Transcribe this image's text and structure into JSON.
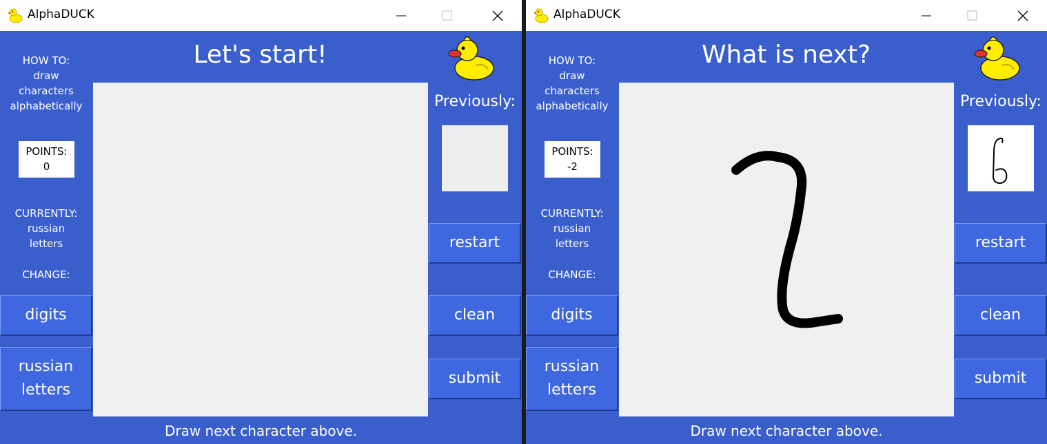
{
  "app": {
    "title": "AlphaDUCK"
  },
  "colors": {
    "background": "#3a5fcd",
    "button": "#3f68e0",
    "canvas": "#f0f0f0",
    "duck_yellow": "#ffee00",
    "duck_beak": "#e53030"
  },
  "windows": [
    {
      "heading": "Let's start!",
      "howto_label": "HOW TO:",
      "howto_text": "draw characters alphabetically",
      "points_label": "POINTS:",
      "points_value": "0",
      "currently_label": "CURRENTLY:",
      "currently_value": "russian letters",
      "change_label": "CHANGE:",
      "buttons": {
        "digits": "digits",
        "russian": "russian letters",
        "restart": "restart",
        "clean": "clean",
        "submit": "submit"
      },
      "previously_label": "Previously:",
      "footer": "Draw next character above.",
      "canvas_has_drawing": false,
      "previous_character": ""
    },
    {
      "heading": "What is next?",
      "howto_label": "HOW TO:",
      "howto_text": "draw characters alphabetically",
      "points_label": "POINTS:",
      "points_value": "-2",
      "currently_label": "CURRENTLY:",
      "currently_value": "russian letters",
      "change_label": "CHANGE:",
      "buttons": {
        "digits": "digits",
        "russian": "russian letters",
        "restart": "restart",
        "clean": "clean",
        "submit": "submit"
      },
      "previously_label": "Previously:",
      "footer": "Draw next character above.",
      "canvas_has_drawing": true,
      "previous_character": "б"
    }
  ],
  "icons": {
    "app_icon": "duck-icon",
    "minimize": "minimize-icon",
    "maximize": "maximize-icon",
    "close": "close-icon",
    "mascot": "duck-mascot-icon"
  }
}
